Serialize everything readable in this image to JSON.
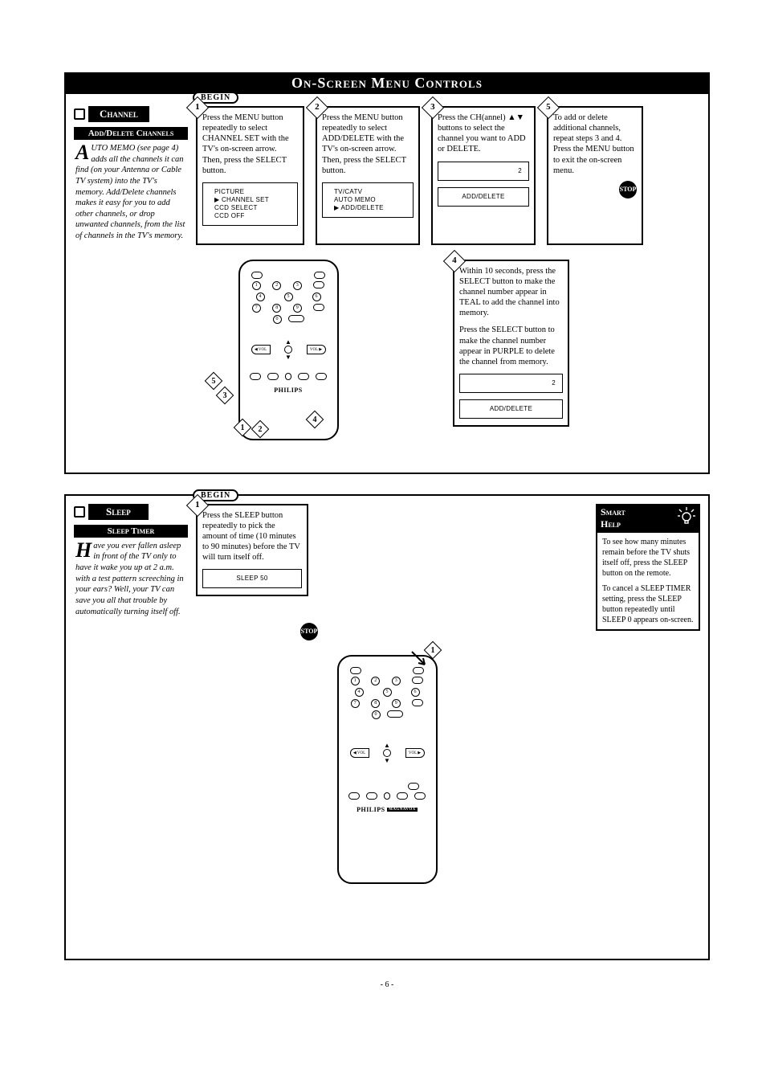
{
  "pageTitle": "On-Screen Menu Controls",
  "pageNumber": "- 6 -",
  "channel": {
    "header": "Channel",
    "subhead": "Add/Delete Channels",
    "begin": "BEGIN",
    "introDrop": "A",
    "intro": "UTO MEMO (see page 4) adds all the channels it can find (on your Antenna or Cable TV system) into the TV's memory. Add/Delete channels makes it easy for you to add other channels, or drop unwanted channels, from the list of channels in the TV's memory.",
    "steps": {
      "s1": {
        "num": "1",
        "text": "Press the MENU button repeatedly to select CHANNEL SET with the TV's on-screen arrow. Then, press the SELECT button.",
        "screen": "PICTURE\n▶ CHANNEL SET\nCCD SELECT\nCCD OFF"
      },
      "s2": {
        "num": "2",
        "text": "Press the MENU button repeatedly to select ADD/DELETE with the TV's on-screen arrow. Then, press the SELECT button.",
        "screen": "TV/CATV\nAUTO MEMO\n▶ ADD/DELETE"
      },
      "s3": {
        "num": "3",
        "text": "Press the CH(annel) ▲▼ buttons to select the channel you want to ADD or DELETE.",
        "screenA": "2",
        "screenB": "ADD/DELETE"
      },
      "s4": {
        "num": "4",
        "textA": "Within 10 seconds, press the SELECT button to make the channel number appear in TEAL to add the channel into memory.",
        "textB": "Press the SELECT button to make the channel number appear in PURPLE to delete the channel from memory.",
        "screenA": "2",
        "screenB": "ADD/DELETE"
      },
      "s5": {
        "num": "5",
        "text": "To add or delete additional channels, repeat steps 3 and 4. Press the MENU button to exit the on-screen menu."
      }
    },
    "stop": "STOP",
    "remote": {
      "brand": "PHILIPS",
      "callouts": [
        "1",
        "2",
        "3",
        "4",
        "5"
      ]
    },
    "navL": "◀ VOL",
    "navR": "VOL ▶"
  },
  "sleep": {
    "header": "Sleep",
    "subhead": "Sleep Timer",
    "begin": "BEGIN",
    "introDrop": "H",
    "intro": "ave you ever fallen asleep in front of the TV only to have it wake you up at 2 a.m. with a test pattern screeching in your ears? Well, your TV can save you all that trouble by automatically turning itself off.",
    "step1": {
      "num": "1",
      "text": "Press the SLEEP button repeatedly to pick the amount of time (10 minutes to 90 minutes) before the TV will turn itself off.",
      "screen": "SLEEP 50"
    },
    "stop": "STOP",
    "help": {
      "title1": "Smart",
      "title2": "Help",
      "p1": "To see how many minutes remain before the TV shuts itself off, press the SLEEP button on the remote.",
      "p2": "To cancel a SLEEP TIMER setting, press the SLEEP button repeatedly until SLEEP 0 appears on-screen."
    },
    "remote": {
      "brand": "PHILIPS",
      "brandSub": "MAGNAVOX",
      "callout": "1"
    }
  }
}
